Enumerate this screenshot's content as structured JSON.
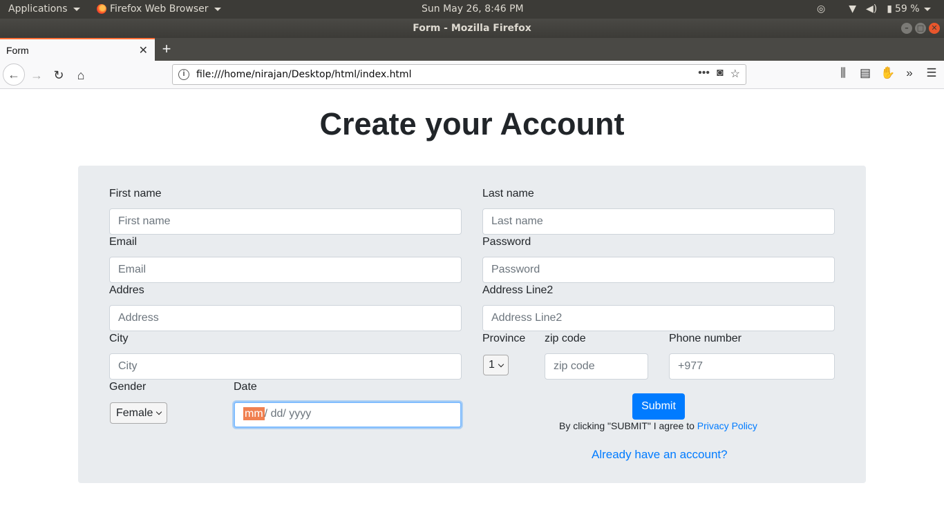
{
  "system_bar": {
    "applications": "Applications",
    "active_app": "Firefox Web Browser",
    "clock": "Sun May 26,  8:46 PM",
    "battery": "59 %"
  },
  "window": {
    "title": "Form - Mozilla Firefox"
  },
  "tabs": [
    {
      "label": "Form"
    }
  ],
  "navbar": {
    "url": "file:///home/nirajan/Desktop/html/index.html"
  },
  "page": {
    "heading": "Create your Account",
    "form": {
      "first_name": {
        "label": "First name",
        "placeholder": "First name"
      },
      "last_name": {
        "label": "Last name",
        "placeholder": "Last name"
      },
      "email": {
        "label": "Email",
        "placeholder": "Email"
      },
      "password": {
        "label": "Password",
        "placeholder": "Password"
      },
      "address": {
        "label": "Addres",
        "placeholder": "Address"
      },
      "address2": {
        "label": "Address Line2",
        "placeholder": "Address Line2"
      },
      "city": {
        "label": "City",
        "placeholder": "City"
      },
      "province": {
        "label": "Province",
        "value": "1"
      },
      "zip": {
        "label": "zip code",
        "placeholder": "zip code"
      },
      "phone": {
        "label": "Phone number",
        "placeholder": "+977"
      },
      "gender": {
        "label": "Gender",
        "value": "Female"
      },
      "date": {
        "label": "Date",
        "mm": "mm",
        "dd": "dd",
        "yyyy": "yyyy",
        "sep": "/"
      },
      "submit_label": "Submit",
      "terms_text": "By clicking \"SUBMIT\" I agree to ",
      "privacy_link": "Privacy Policy",
      "login_link": "Already have an account?"
    }
  }
}
